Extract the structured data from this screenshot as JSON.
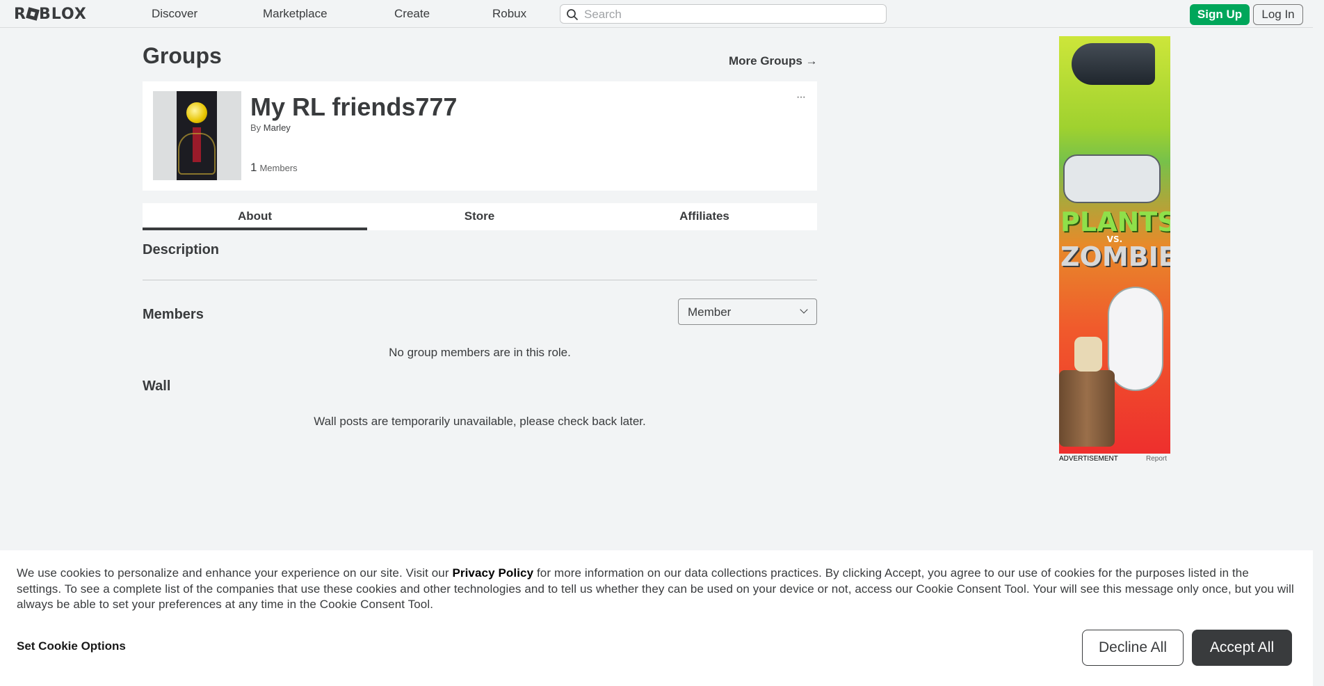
{
  "header": {
    "logo": "ROBLOX",
    "nav": [
      "Discover",
      "Marketplace",
      "Create",
      "Robux"
    ],
    "search_placeholder": "Search",
    "signup_label": "Sign Up",
    "login_label": "Log In"
  },
  "page": {
    "title": "Groups",
    "more_groups": "More Groups →"
  },
  "group": {
    "name": "My RL friends777",
    "by_prefix": "By",
    "owner": "Marley",
    "member_count": "1",
    "members_label": "Members",
    "more_icon": "···"
  },
  "tabs": [
    "About",
    "Store",
    "Affiliates"
  ],
  "about": {
    "description_title": "Description",
    "members_title": "Members",
    "role_selected": "Member",
    "no_members_msg": "No group members are in this role.",
    "wall_title": "Wall",
    "wall_msg": "Wall posts are temporarily unavailable, please check back later."
  },
  "ad": {
    "label": "ADVERTISEMENT",
    "report": "Report",
    "plants": "PLANTS",
    "vs": "VS.",
    "zombies": "ZOMBIES"
  },
  "cookie": {
    "text_before_link": "We use cookies to personalize and enhance your experience on our site. Visit our ",
    "privacy_link": "Privacy Policy",
    "text_after_link": " for more information on our data collections practices. By clicking Accept, you agree to our use of cookies for the purposes listed in the settings. To see a complete list of the companies that use these cookies and other technologies and to tell us whether they can be used on your device or not, access our Cookie Consent Tool. Your will see this message only once, but you will always be able to set your preferences at any time in the Cookie Consent Tool.",
    "set_options": "Set Cookie Options",
    "decline": "Decline All",
    "accept": "Accept All"
  },
  "colors": {
    "signup_green": "#00a65a",
    "text_dark": "#393b3d",
    "bg": "#f2f4f5"
  }
}
